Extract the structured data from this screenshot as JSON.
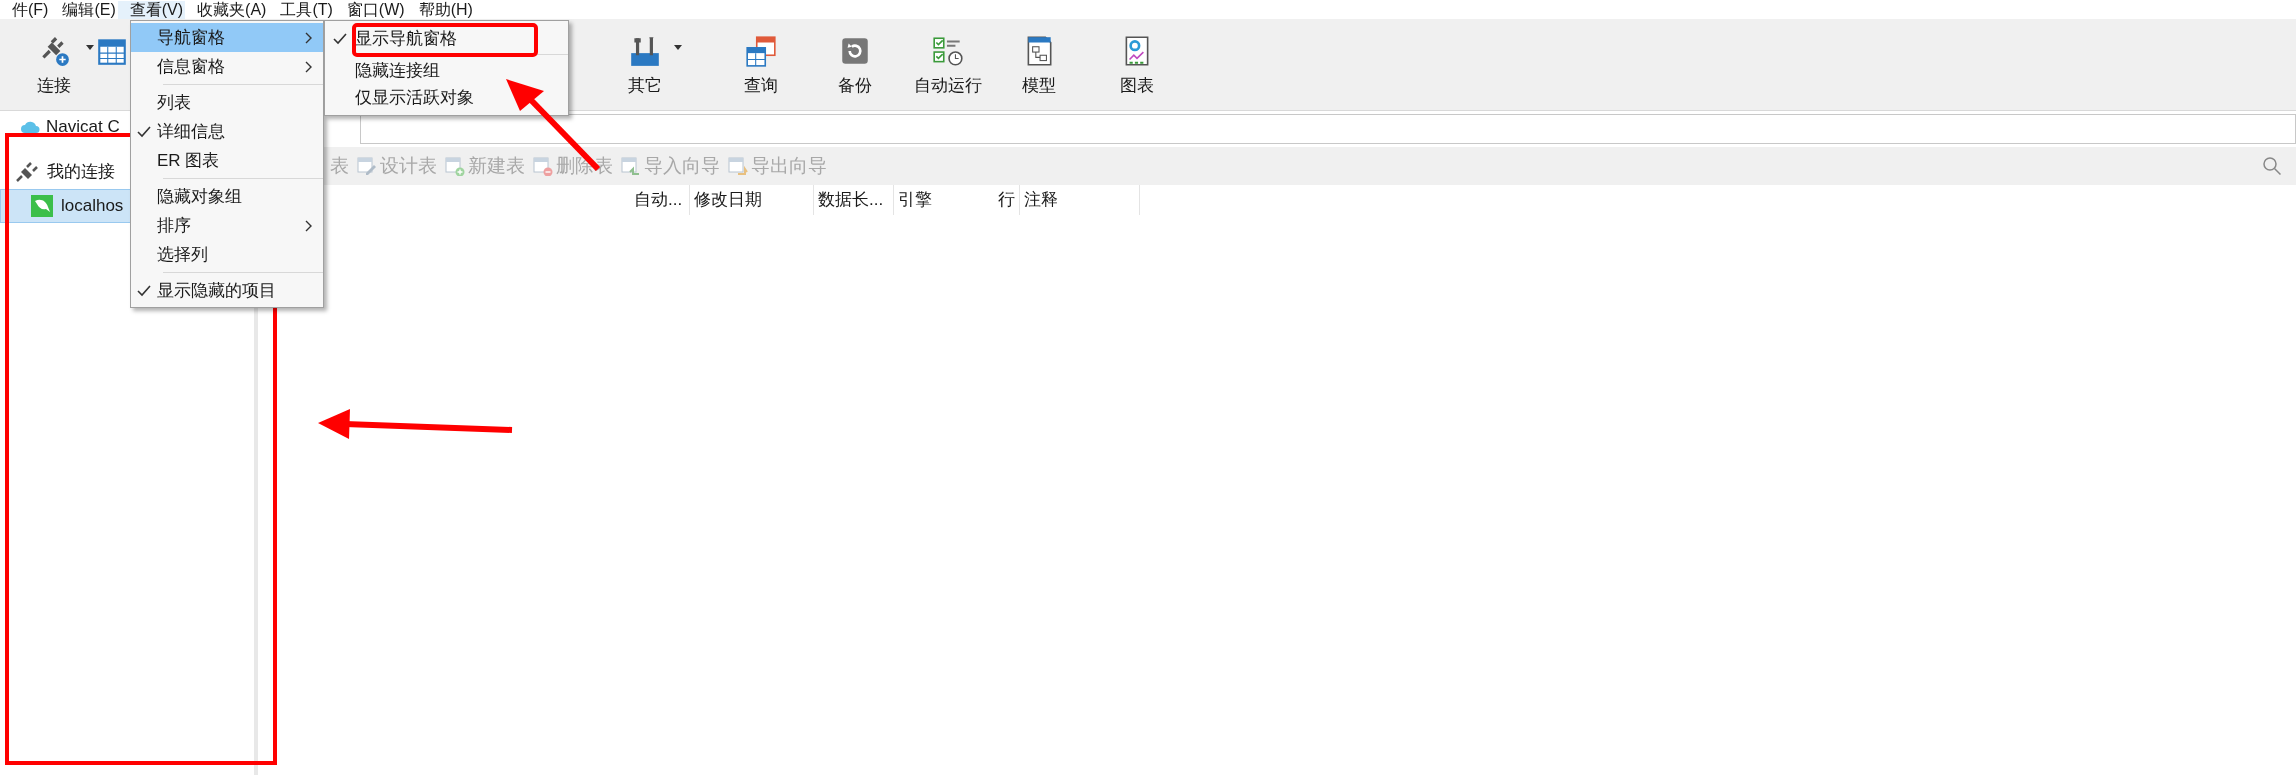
{
  "menu_bar": [
    {
      "label": "件(F)",
      "selected": false
    },
    {
      "label": "编辑(E)",
      "selected": false
    },
    {
      "label": "查看(V)",
      "selected": true
    },
    {
      "label": "收藏夹(A)",
      "selected": false
    },
    {
      "label": "工具(T)",
      "selected": false
    },
    {
      "label": "窗口(W)",
      "selected": false
    },
    {
      "label": "帮助(H)",
      "selected": false
    }
  ],
  "toolbar": [
    {
      "label": "连接",
      "kind": "plug",
      "dropdown": true
    },
    {
      "kind": "table"
    },
    {
      "label": "其它",
      "kind": "tools",
      "dropdown": true
    },
    {
      "label": "查询",
      "kind": "query",
      "dropdown": false
    },
    {
      "label": "备份",
      "kind": "backup",
      "dropdown": false
    },
    {
      "label": "自动运行",
      "kind": "schedule",
      "dropdown": false
    },
    {
      "label": "模型",
      "kind": "model",
      "dropdown": false
    },
    {
      "label": "图表",
      "kind": "chart",
      "dropdown": false
    }
  ],
  "navigation": {
    "header": "Navicat C",
    "items": [
      {
        "label": "我的连接",
        "kind": "group",
        "selected": false,
        "children": [
          {
            "label": "localhos",
            "kind": "connection",
            "selected": true
          }
        ]
      }
    ]
  },
  "object_toolbar": [
    {
      "label": "表",
      "kind": "none"
    },
    {
      "label": "设计表",
      "kind": "design"
    },
    {
      "label": "新建表",
      "kind": "new"
    },
    {
      "label": "删除表",
      "kind": "delete"
    },
    {
      "label": "导入向导",
      "kind": "import"
    },
    {
      "label": "导出向导",
      "kind": "export"
    }
  ],
  "table": {
    "columns": [
      "自动...",
      "修改日期",
      "数据长...",
      "引擎",
      "行",
      "注释"
    ]
  },
  "view_menu": [
    {
      "label": "导航窗格",
      "kind": "item",
      "submenu": true,
      "checked": false,
      "selected": true
    },
    {
      "label": "信息窗格",
      "kind": "item",
      "submenu": true,
      "checked": false,
      "selected": false
    },
    {
      "kind": "separator"
    },
    {
      "label": "列表",
      "kind": "item",
      "submenu": false,
      "checked": false,
      "selected": false
    },
    {
      "label": "详细信息",
      "kind": "item",
      "submenu": false,
      "checked": true,
      "selected": false
    },
    {
      "label": "ER 图表",
      "kind": "item",
      "submenu": false,
      "checked": false,
      "selected": false
    },
    {
      "kind": "separator"
    },
    {
      "label": "隐藏对象组",
      "kind": "item",
      "submenu": false,
      "checked": false,
      "selected": false
    },
    {
      "label": "排序",
      "kind": "item",
      "submenu": true,
      "checked": false,
      "selected": false
    },
    {
      "label": "选择列",
      "kind": "item",
      "submenu": false,
      "checked": false,
      "selected": false
    },
    {
      "kind": "separator"
    },
    {
      "label": "显示隐藏的项目",
      "kind": "item",
      "submenu": false,
      "checked": true,
      "selected": false
    }
  ],
  "navigation_submenu": [
    {
      "label": "显示导航窗格",
      "kind": "item",
      "checked": true
    },
    {
      "kind": "separator"
    },
    {
      "label": "隐藏连接组",
      "kind": "item",
      "checked": false
    },
    {
      "label": "仅显示活跃对象",
      "kind": "item",
      "checked": false
    }
  ]
}
